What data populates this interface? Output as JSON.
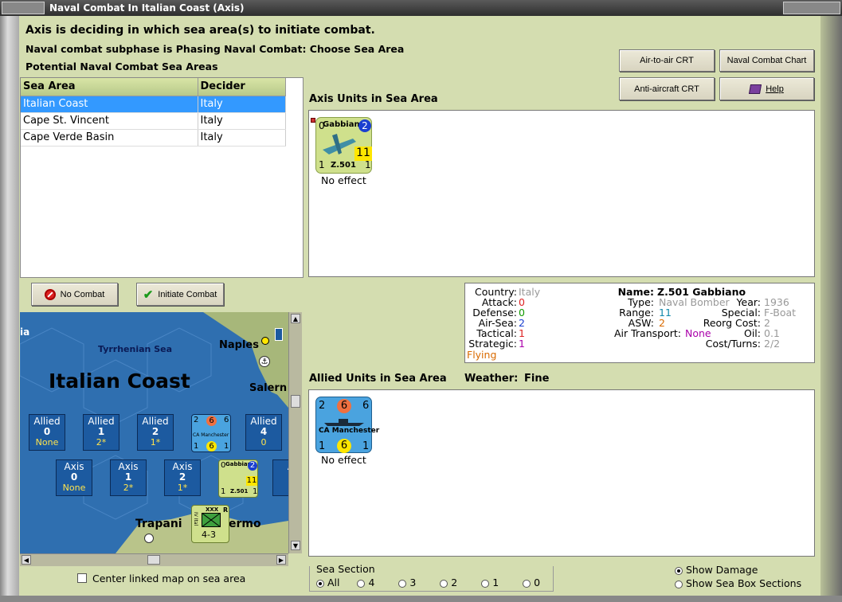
{
  "window": {
    "title": "Naval Combat In Italian Coast (Axis)"
  },
  "header": {
    "line1": "Axis is deciding in which sea area(s) to initiate combat.",
    "line2": "Naval combat subphase is Phasing Naval Combat: Choose Sea Area",
    "line3": "Potential Naval Combat Sea Areas"
  },
  "buttons": {
    "air_to_air": "Air-to-air CRT",
    "naval_chart": "Naval Combat Chart",
    "anti_aircraft": "Anti-aircraft CRT",
    "help": "Help",
    "no_combat": "No Combat",
    "initiate_combat": "Initiate Combat"
  },
  "sea_table": {
    "columns": [
      "Sea Area",
      "Decider"
    ],
    "rows": [
      {
        "area": "Italian Coast",
        "decider": "Italy"
      },
      {
        "area": "Cape St. Vincent",
        "decider": "Italy"
      },
      {
        "area": "Cape Verde Basin",
        "decider": "Italy"
      }
    ]
  },
  "axis_units": {
    "label": "Axis Units in Sea Area",
    "unit": {
      "name": "Gabbiano",
      "model": "Z.501",
      "top_left": "0",
      "top_right": "2",
      "attack": "11",
      "bl": "1",
      "br": "1",
      "status": "No effect"
    }
  },
  "allied_units": {
    "label": "Allied Units in Sea Area",
    "weather_label": "Weather:",
    "weather_value": "Fine",
    "unit": {
      "name": "CA Manchester",
      "tl": "2",
      "tm": "6",
      "tr": "6",
      "bl": "1",
      "bm": "6",
      "br": "1",
      "status": "No effect"
    }
  },
  "info": {
    "country_k": "Country:",
    "country_v": "Italy",
    "attack_k": "Attack:",
    "attack_v": "0",
    "defense_k": "Defense:",
    "defense_v": "0",
    "airsea_k": "Air-Sea:",
    "airsea_v": "2",
    "tactical_k": "Tactical:",
    "tactical_v": "1",
    "strategic_k": "Strategic:",
    "strategic_v": "1",
    "flying": "Flying",
    "name_k": "Name:",
    "name_v": "Z.501 Gabbiano",
    "type_k": "Type:",
    "type_v": "Naval Bomber",
    "year_k": "Year:",
    "year_v": "1936",
    "range_k": "Range:",
    "range_v": "11",
    "special_k": "Special:",
    "special_v": "F-Boat",
    "asw_k": "ASW:",
    "asw_v": "2",
    "reorg_k": "Reorg Cost:",
    "reorg_v": "2",
    "airtrans_k": "Air Transport:",
    "airtrans_v": "None",
    "oil_k": "Oil:",
    "oil_v": "0.1",
    "cost_k": "Cost/Turns:",
    "cost_v": "2/2"
  },
  "map": {
    "edge_label": "ia",
    "sea_name": "Tyrrhenian Sea",
    "title": "Italian Coast",
    "naples": "Naples",
    "salerno": "Salern",
    "trapani": "Trapani",
    "palermo": "ermo",
    "allied_boxes": [
      {
        "side": "Allied",
        "num": "0",
        "sub": "None"
      },
      {
        "side": "Allied",
        "num": "1",
        "sub": "2*"
      },
      {
        "side": "Allied",
        "num": "2",
        "sub": "1*"
      },
      {
        "side": "Allied",
        "num": "4",
        "sub": "0"
      }
    ],
    "axis_boxes": [
      {
        "side": "Axis",
        "num": "0",
        "sub": "None"
      },
      {
        "side": "Axis",
        "num": "1",
        "sub": "2*"
      },
      {
        "side": "Axis",
        "num": "2",
        "sub": "1*"
      },
      {
        "side": "A",
        "num": "",
        "sub": ""
      }
    ],
    "corps": {
      "xxx": "XXX",
      "r": "R",
      "side": "IV Ital",
      "strength": "4-3"
    },
    "mini_ca": {
      "tl": "2",
      "tm": "6",
      "tr": "6",
      "name": "CA Manchester",
      "bl": "1",
      "bm": "6",
      "br": "1"
    },
    "mini_z": {
      "tl": "0",
      "name": "Gabbiano",
      "tr": "2",
      "attack": "11",
      "model": "Z.501",
      "bl": "1",
      "br": "1"
    }
  },
  "center_linked": "Center linked map on sea area",
  "sea_section": {
    "label": "Sea Section",
    "options": [
      "All",
      "4",
      "3",
      "2",
      "1",
      "0"
    ]
  },
  "options": {
    "show_damage": "Show Damage",
    "show_sea_box": "Show Sea Box Sections"
  },
  "colors": {
    "selection": "#3399ff",
    "unit_axis": "#cfe08c",
    "unit_allied": "#4aa3df",
    "sea": "#2f6fb0"
  }
}
